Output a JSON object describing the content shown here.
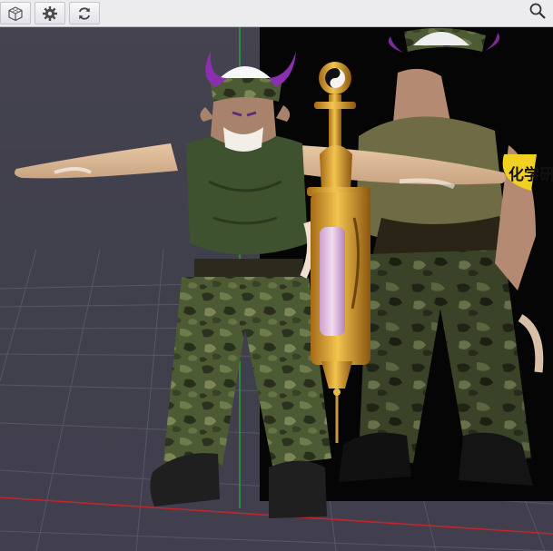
{
  "toolbar": {
    "buttons": [
      {
        "name": "view-cube-button",
        "icon": "cube-icon"
      },
      {
        "name": "settings-button",
        "icon": "gear-icon"
      },
      {
        "name": "reset-view-button",
        "icon": "refresh-icon"
      }
    ],
    "search_icon": "search-icon"
  },
  "viewport": {
    "reference_armband_text": "化学研",
    "colors": {
      "background": "#3f3e4d",
      "grid": "#5b5a6a",
      "axis_x": "#c0262a",
      "axis_y": "#2aa83a"
    }
  }
}
